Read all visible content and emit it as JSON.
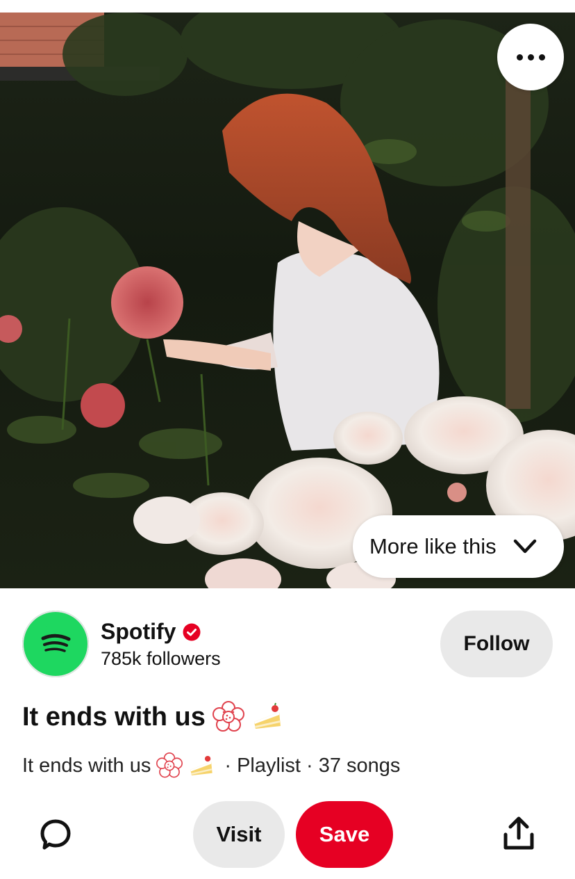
{
  "pin": {
    "more_like_this_label": "More like this"
  },
  "creator": {
    "name": "Spotify",
    "followers": "785k followers",
    "follow_label": "Follow",
    "brand_color": "#1ed760"
  },
  "title": "It ends with us",
  "description": {
    "text": "It ends with us",
    "meta": "· Playlist · 37 songs"
  },
  "actions": {
    "visit_label": "Visit",
    "save_label": "Save",
    "save_color": "#e60023"
  },
  "icons": {
    "more": "more-options-icon",
    "chevron": "chevron-down-icon",
    "verified": "verified-badge-icon",
    "comment": "comment-icon",
    "share": "share-icon",
    "emoji_1": "flower-emoji-icon",
    "emoji_2": "cake-emoji-icon"
  }
}
